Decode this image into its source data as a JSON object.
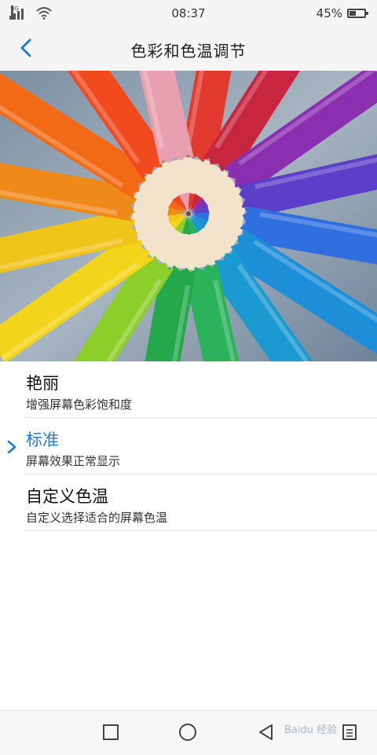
{
  "status_bar": {
    "network_label": "4G",
    "time": "08:37",
    "battery_text": "45%",
    "battery_level": 0.45
  },
  "header": {
    "title": "色彩和色温调节",
    "back_icon": "chevron-left-icon"
  },
  "banner": {
    "description_icon": "colored-pencils-image"
  },
  "options": [
    {
      "title": "艳丽",
      "subtitle": "增强屏幕色彩饱和度",
      "selected": false
    },
    {
      "title": "标准",
      "subtitle": "屏幕效果正常显示",
      "selected": true
    },
    {
      "title": "自定义色温",
      "subtitle": "自定义选择适合的屏幕色温",
      "selected": false
    }
  ],
  "navbar": {
    "recents_icon": "square-icon",
    "home_icon": "circle-icon",
    "back_icon": "triangle-back-icon",
    "menu_icon": "menu-icon"
  },
  "watermark": "Baidu 经验",
  "colors": {
    "accent": "#1e7bd6",
    "background": "#ffffff",
    "bar_background": "#f5f5f5"
  }
}
